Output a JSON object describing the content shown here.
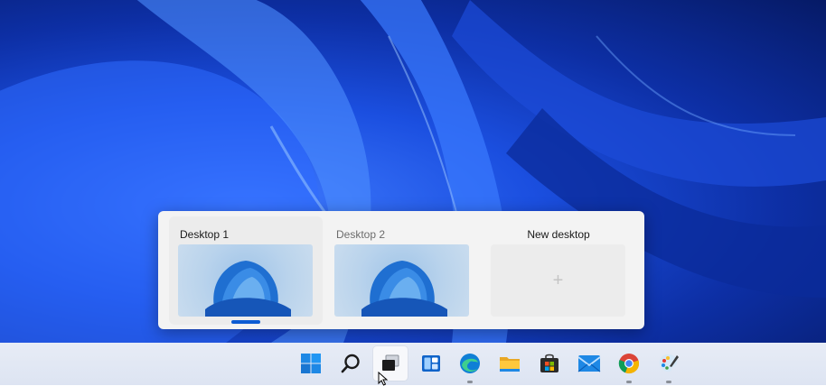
{
  "task_view": {
    "desktops": [
      {
        "label": "Desktop 1",
        "active": true
      },
      {
        "label": "Desktop 2",
        "active": false
      }
    ],
    "new_desktop": {
      "label": "New desktop",
      "plus": "+"
    }
  },
  "taskbar": {
    "items": [
      {
        "name": "start-button",
        "icon": "windows-logo-icon"
      },
      {
        "name": "search-button",
        "icon": "search-icon"
      },
      {
        "name": "task-view-button",
        "icon": "task-view-icon",
        "active": true
      },
      {
        "name": "widgets-button",
        "icon": "widgets-icon"
      },
      {
        "name": "edge-button",
        "icon": "edge-icon",
        "running": true
      },
      {
        "name": "file-explorer-button",
        "icon": "folder-icon"
      },
      {
        "name": "store-button",
        "icon": "store-icon"
      },
      {
        "name": "mail-button",
        "icon": "mail-icon"
      },
      {
        "name": "chrome-button",
        "icon": "chrome-icon",
        "running": true
      },
      {
        "name": "paint-button",
        "icon": "paint-icon",
        "running": true
      }
    ]
  },
  "colors": {
    "accent": "#0c5bd3",
    "start_blue": "#1e88e5"
  }
}
